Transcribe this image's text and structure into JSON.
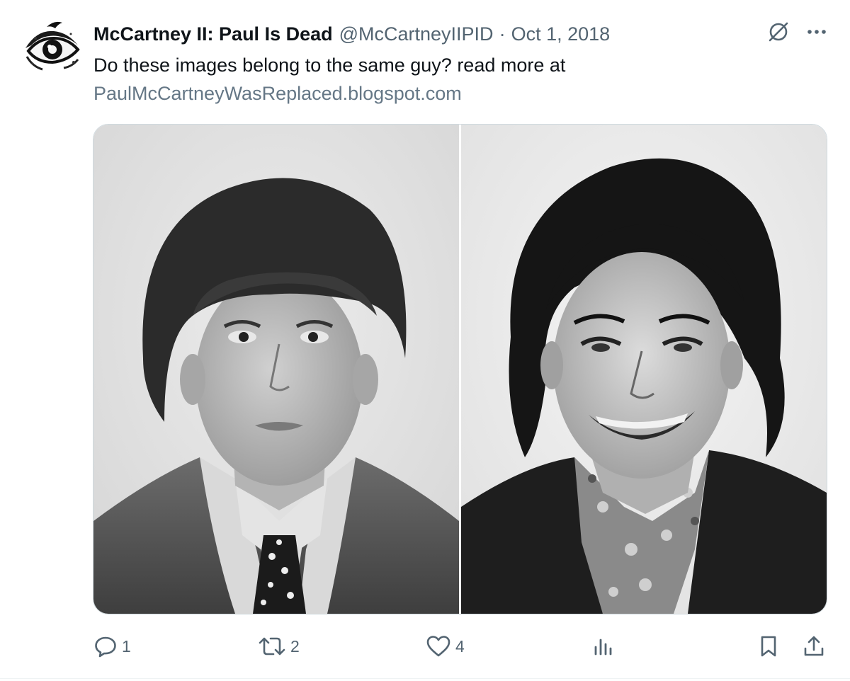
{
  "tweet": {
    "display_name": "McCartney II: Paul Is Dead",
    "handle": "@McCartneyIIPID",
    "separator": "·",
    "date": "Oct 1, 2018",
    "text": "Do these images belong to the same guy? read more at",
    "link_text": "PaulMcCartneyWasReplaced.blogspot.com"
  },
  "top_actions": {
    "grok_icon": "slashed-circle-icon",
    "more_icon": "more-dots-icon"
  },
  "media": {
    "left_photo": "black-and-white portrait, mop-top haircut, tweed jacket, floral tie",
    "right_photo": "black-and-white portrait, smiling, longer hair, dark jacket, patterned scarf"
  },
  "actions": {
    "reply_count": "1",
    "retweet_count": "2",
    "like_count": "4",
    "views_icon": "bar-chart-icon",
    "bookmark_icon": "bookmark-icon",
    "share_icon": "share-icon"
  },
  "colors": {
    "text_primary": "#0f1419",
    "text_secondary": "#536471",
    "border": "#cfd9de"
  }
}
